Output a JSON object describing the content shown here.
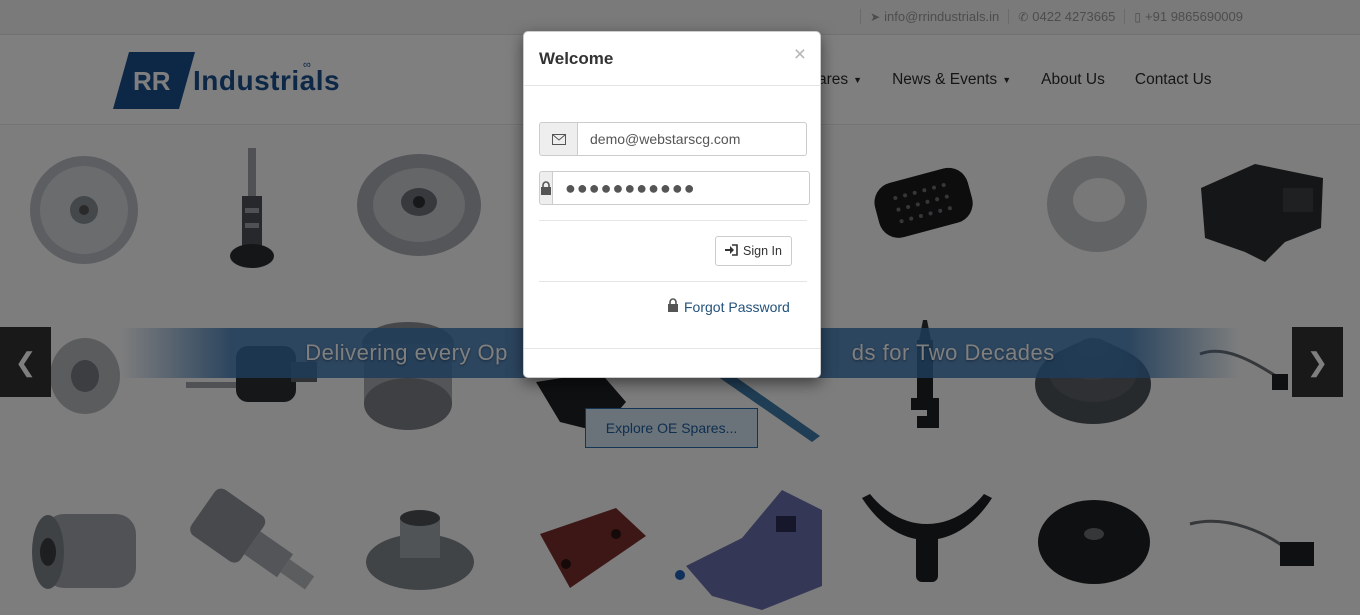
{
  "topbar": {
    "email": "info@rrindustrials.in",
    "phone": "0422 4273665",
    "mobile": "+91 9865690009",
    "email_icon": "paper-plane-icon",
    "phone_icon": "phone-icon",
    "mobile_icon": "mobile-icon"
  },
  "header": {
    "logo_mark": "RR",
    "logo_text": "Industrials",
    "nav": [
      {
        "label": "ares",
        "dropdown": true
      },
      {
        "label": "News & Events",
        "dropdown": true
      },
      {
        "label": "About Us",
        "dropdown": false
      },
      {
        "label": "Contact Us",
        "dropdown": false
      }
    ]
  },
  "hero": {
    "banner_text": "Delivering every Op                                                    ds for Two Decades",
    "explore_label": "Explore OE Spares...",
    "prev_icon": "chevron-left-icon",
    "next_icon": "chevron-right-icon"
  },
  "modal": {
    "title": "Welcome",
    "close_label": "×",
    "email_value": "demo@webstarscg.com",
    "password_value": "●●●●●●●●●●●",
    "signin_label": "Sign In",
    "forgot_label": "Forgot Password"
  },
  "colors": {
    "brand_blue": "#1b4f8e",
    "link": "#23527c",
    "overlay": "rgba(0,0,0,0.5)"
  }
}
